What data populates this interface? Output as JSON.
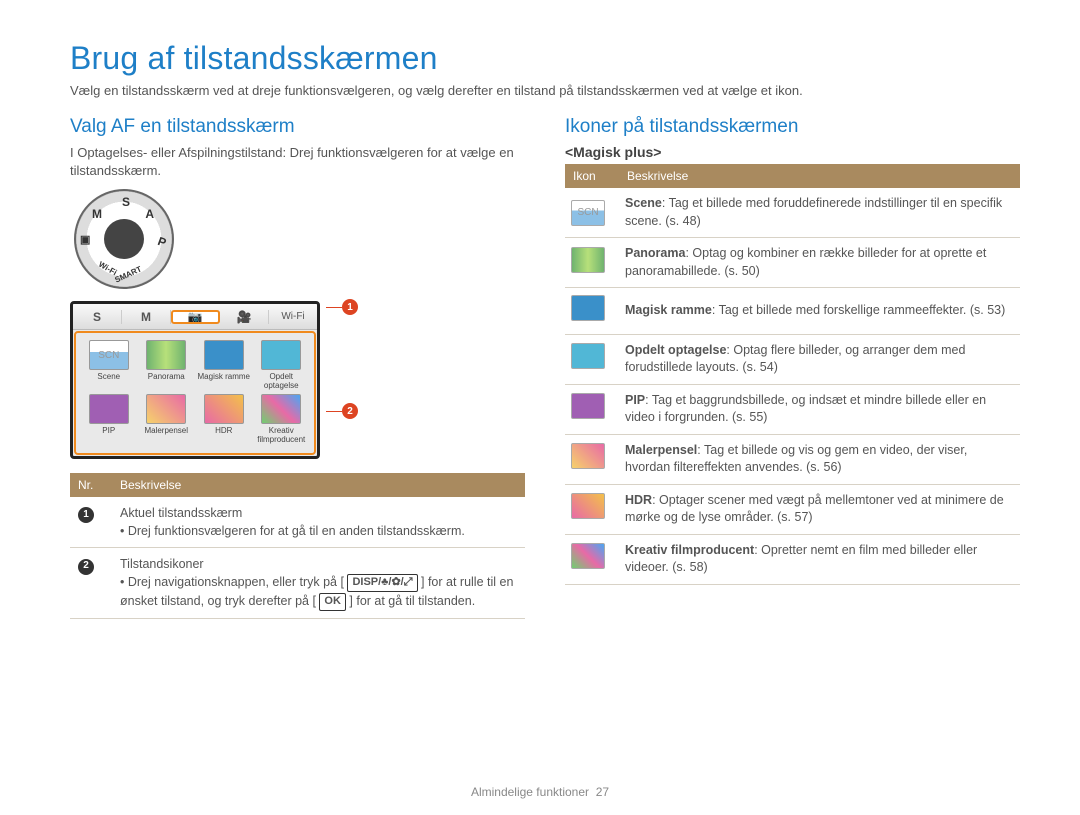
{
  "page_title": "Brug af tilstandsskærmen",
  "intro": "Vælg en tilstandsskærm ved at dreje funktionsvælgeren, og vælg derefter en tilstand på tilstandsskærmen ved at vælge et ikon.",
  "left": {
    "heading": "Valg AF en tilstandsskærm",
    "sub": "I Optagelses- eller Afspilningstilstand: Drej funktionsvælgeren for at vælge en tilstandsskærm.",
    "dial_letters": {
      "s": "S",
      "a": "A",
      "p": "P",
      "smart": "SMART",
      "wifi": "Wi-Fi",
      "m": "M"
    },
    "tabs": {
      "s": "S",
      "m": "M",
      "wifi": "Wi-Fi"
    },
    "grid_labels": {
      "scene": "Scene",
      "panorama": "Panorama",
      "ramme": "Magisk ramme",
      "opdelt": "Opdelt optagelse",
      "pip": "PIP",
      "pensel": "Malerpensel",
      "hdr": "HDR",
      "movie": "Kreativ filmproducent"
    },
    "table_head": {
      "nr": "Nr.",
      "besk": "Beskrivelse"
    },
    "row1": {
      "title": "Aktuel tilstandsskærm",
      "bullet": "Drej funktionsvælgeren for at gå til en anden tilstandsskærm."
    },
    "row2": {
      "title": "Tilstandsikoner",
      "bullet_a": "Drej navigationsknappen, eller tryk på [",
      "btn1": "DISP/♣/✿/⤢",
      "bullet_b": "] for at rulle til en ønsket tilstand, og tryk derefter på [",
      "btn2": "OK",
      "bullet_c": "] for at gå til tilstanden."
    }
  },
  "right": {
    "heading": "Ikoner på tilstandsskærmen",
    "subhead": "<Magisk plus>",
    "table_head": {
      "ikon": "Ikon",
      "besk": "Beskrivelse"
    },
    "rows": [
      {
        "bold": "Scene",
        "rest": ": Tag et billede med foruddefinerede indstillinger til en specifik scene. (s. 48)"
      },
      {
        "bold": "Panorama",
        "rest": ": Optag og kombiner en række billeder for at oprette et panoramabillede. (s. 50)"
      },
      {
        "bold": "Magisk ramme",
        "rest": ": Tag et billede med forskellige rammeeffekter. (s. 53)"
      },
      {
        "bold": "Opdelt optagelse",
        "rest": ": Optag flere billeder, og arranger dem med forudstillede layouts. (s. 54)"
      },
      {
        "bold": "PIP",
        "rest": ": Tag et baggrundsbillede, og indsæt et mindre billede eller en video i forgrunden. (s. 55)"
      },
      {
        "bold": "Malerpensel",
        "rest": ": Tag et billede og vis og gem en video, der viser, hvordan filtereffekten anvendes. (s. 56)"
      },
      {
        "bold": "HDR",
        "rest": ": Optager scener med vægt på mellemtoner ved at minimere de mørke og de lyse områder. (s. 57)"
      },
      {
        "bold": "Kreativ filmproducent",
        "rest": ": Opretter nemt en film med billeder eller videoer. (s. 58)"
      }
    ]
  },
  "footer": {
    "text": "Almindelige funktioner",
    "page": "27"
  }
}
